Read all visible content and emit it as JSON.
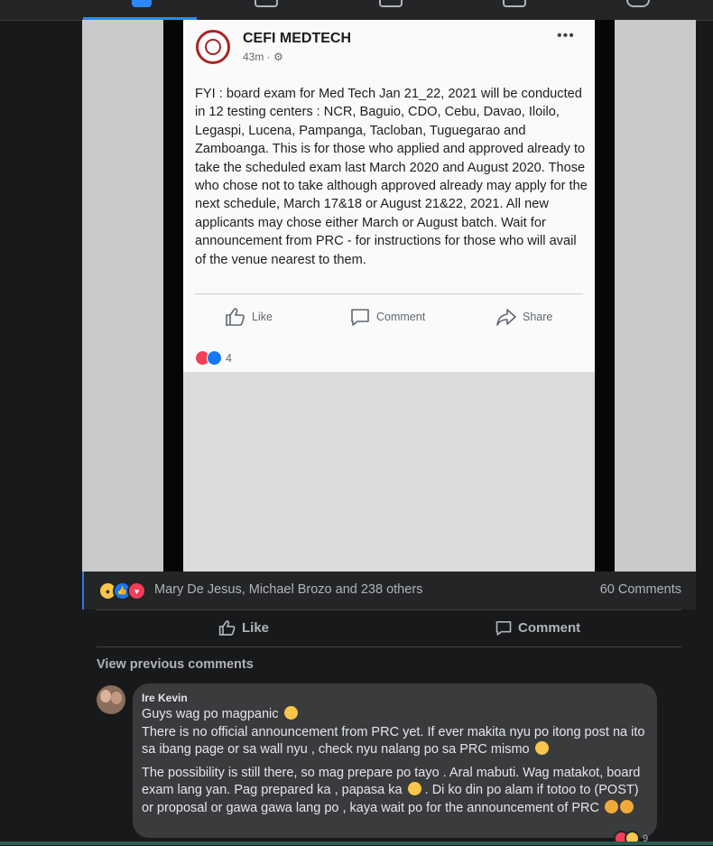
{
  "nav": {
    "icons": [
      "home-icon",
      "watch-icon",
      "marketplace-icon",
      "groups-icon",
      "gaming-icon"
    ]
  },
  "post_image": {
    "page_name": "CEFI MEDTECH",
    "time": "43m ·",
    "more": "•••",
    "text": "FYI : board exam for Med Tech Jan 21_22, 2021 will be conducted in 12 testing centers : NCR, Baguio, CDO, Cebu, Davao, Iloilo, Legaspi, Lucena, Pampanga, Tacloban, Tuguegarao and Zamboanga. This is for those who applied and approved already to take the scheduled exam last March 2020 and August 2020. Those who chose not to take although approved already may apply for the next schedule, March 17&18 or August 21&22, 2021. All new applicants may chose either March or August batch. Wait for announcement from PRC - for instructions for those who will avail of the venue nearest to them.",
    "like": "Like",
    "comment": "Comment",
    "share": "Share",
    "reaction_count": "4"
  },
  "meta": {
    "reactors": "Mary De Jesus, Michael Brozo and 238 others",
    "comments_count": "60 Comments"
  },
  "actions": {
    "like": "Like",
    "comment": "Comment"
  },
  "comments": {
    "view_previous": "View previous comments",
    "items": [
      {
        "author": "Ire Kevin",
        "lines": [
          "Guys wag po magpanic",
          "There is no official announcement from PRC yet. If ever makita nyu po itong post na ito sa ibang page or sa wall nyu , check nyu nalang po sa PRC mismo",
          "The possibility is still there, so mag prepare po tayo . Aral mabuti. Wag matakot, board exam lang yan. Pag prepared ka , papasa ka",
          ". Di ko din po alam if totoo to (POST) or proposal or gawa gawa lang po , kaya wait po for the announcement of PRC"
        ],
        "reaction_count": "9"
      }
    ]
  },
  "colors": {
    "accent": "#2d88ff",
    "like_blue": "#1877f2",
    "love_red": "#f33e58",
    "haha_yellow": "#f7c64b"
  }
}
